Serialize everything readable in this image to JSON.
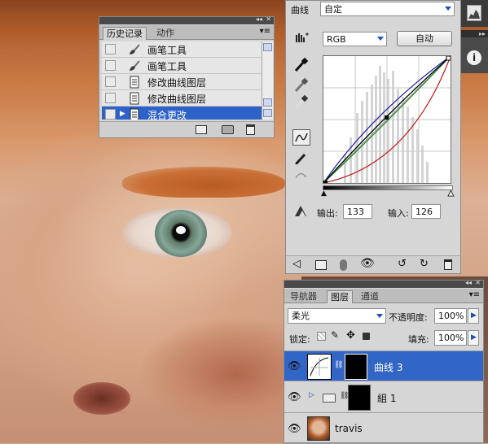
{
  "history_panel": {
    "tabs": [
      "历史记录",
      "动作"
    ],
    "items": [
      {
        "label": "画笔工具",
        "icon": "brush-icon"
      },
      {
        "label": "画笔工具",
        "icon": "brush-icon"
      },
      {
        "label": "修改曲线图层",
        "icon": "document-icon"
      },
      {
        "label": "修改曲线图层",
        "icon": "document-icon"
      },
      {
        "label": "混合更改",
        "icon": "document-icon",
        "selected": true
      }
    ]
  },
  "curves_panel": {
    "type_label": "曲线",
    "preset_value": "自定",
    "channel_value": "RGB",
    "auto_button": "自动",
    "output_label": "输出:",
    "output_value": "133",
    "input_label": "输入:",
    "input_value": "126"
  },
  "layers_panel": {
    "tabs": [
      "导航器",
      "图层",
      "通道"
    ],
    "blend_mode": "柔光",
    "opacity_label": "不透明度:",
    "opacity_value": "100%",
    "lock_label": "锁定:",
    "fill_label": "填充:",
    "fill_value": "100%",
    "layers": [
      {
        "name": "曲线 3",
        "selected": true
      },
      {
        "name": "組 1"
      },
      {
        "name": "travis"
      }
    ]
  },
  "colors": {
    "selection": "#2d62c8",
    "panel_bg": "#d6d6d6",
    "curve_rgb": "#000000",
    "curve_blue": "#1a1aa8",
    "curve_green": "#1f8a1f",
    "curve_red": "#c21818"
  }
}
